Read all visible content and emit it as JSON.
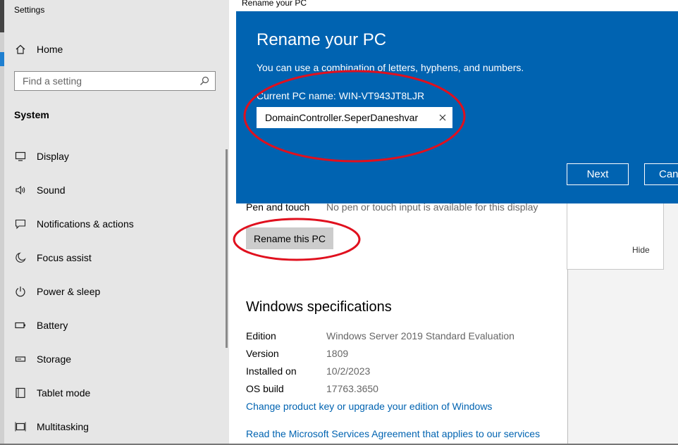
{
  "settings": {
    "app_title": "Settings",
    "home_label": "Home",
    "search_placeholder": "Find a setting",
    "section_title": "System",
    "nav_items": [
      {
        "label": "Display",
        "icon": "display-icon"
      },
      {
        "label": "Sound",
        "icon": "sound-icon"
      },
      {
        "label": "Notifications & actions",
        "icon": "notifications-icon"
      },
      {
        "label": "Focus assist",
        "icon": "moon-icon"
      },
      {
        "label": "Power & sleep",
        "icon": "power-icon"
      },
      {
        "label": "Battery",
        "icon": "battery-icon"
      },
      {
        "label": "Storage",
        "icon": "storage-icon"
      },
      {
        "label": "Tablet mode",
        "icon": "tablet-icon"
      },
      {
        "label": "Multitasking",
        "icon": "multitasking-icon"
      }
    ]
  },
  "about": {
    "pen_label": "Pen and touch",
    "pen_value": "No pen or touch input is available for this display",
    "rename_button": "Rename this PC",
    "spec_title": "Windows specifications",
    "specs": [
      {
        "label": "Edition",
        "value": "Windows Server 2019 Standard Evaluation"
      },
      {
        "label": "Version",
        "value": "1809"
      },
      {
        "label": "Installed on",
        "value": "10/2/2023"
      },
      {
        "label": "OS build",
        "value": "17763.3650"
      }
    ],
    "links": [
      "Change product key or upgrade your edition of Windows",
      "Read the Microsoft Services Agreement that applies to our services"
    ],
    "side_panel_hide": "Hide"
  },
  "dialog": {
    "window_title": "Rename your PC",
    "heading": "Rename your PC",
    "description": "You can use a combination of letters, hyphens, and numbers.",
    "current_name": "Current PC name: WIN-VT943JT8LJR",
    "input_value": "DomainController.SeperDaneshvar",
    "next_button": "Next",
    "cancel_button": "Cancel"
  },
  "colors": {
    "dialog_accent": "#0063b1",
    "annotation_red": "#e0101e",
    "link_blue": "#0063b1"
  }
}
